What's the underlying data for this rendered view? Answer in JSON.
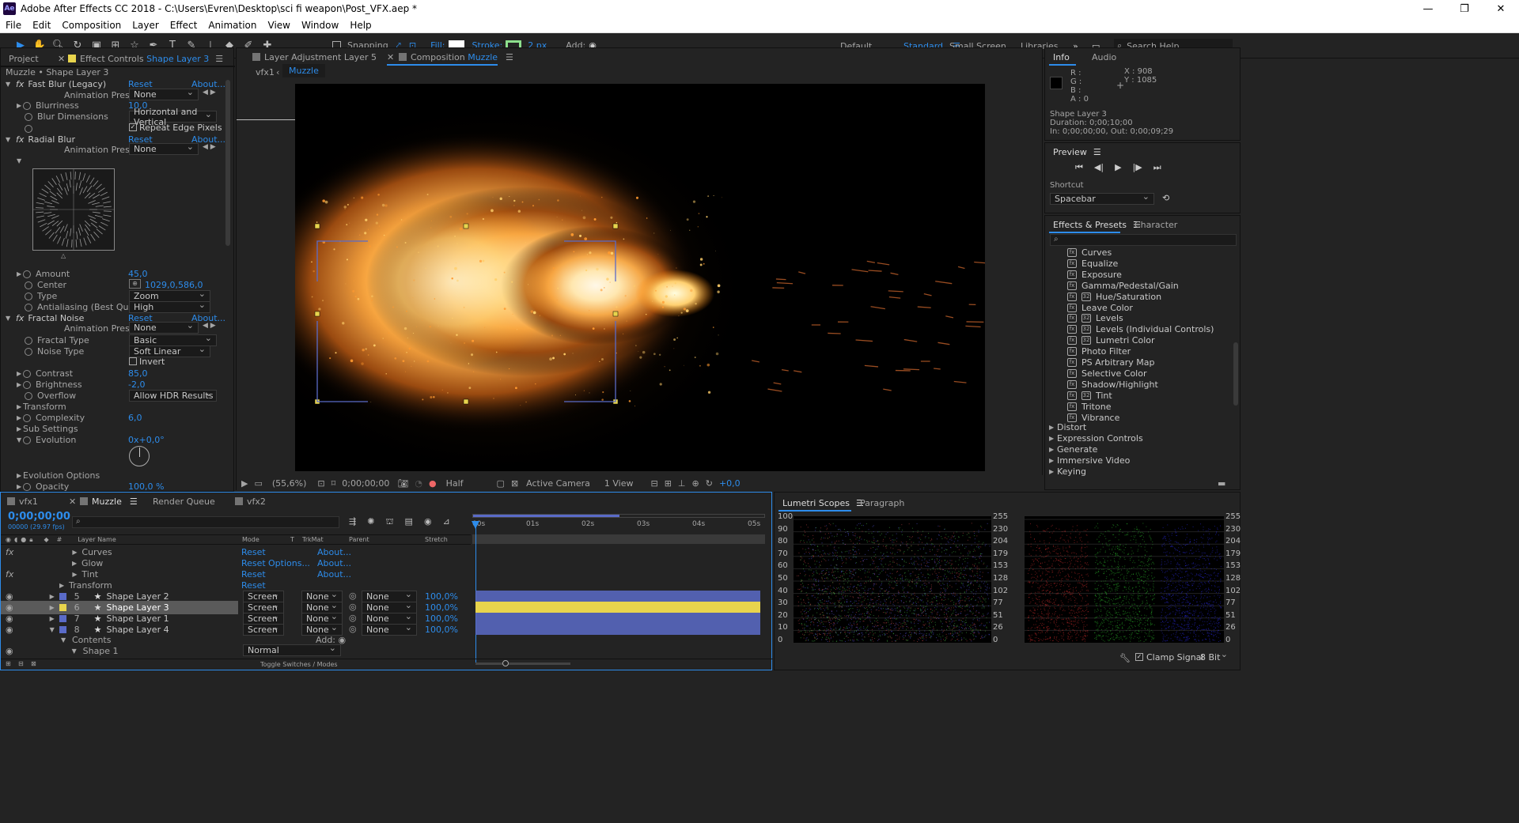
{
  "window": {
    "title": "Adobe After Effects CC 2018 - C:\\Users\\Evren\\Desktop\\sci fi weapon\\Post_VFX.aep *",
    "logo": "Ae",
    "minimize": "—",
    "maximize": "❐",
    "close": "✕"
  },
  "menu": [
    "File",
    "Edit",
    "Composition",
    "Layer",
    "Effect",
    "Animation",
    "View",
    "Window",
    "Help"
  ],
  "toolbar": {
    "snapping": "Snapping",
    "fill": "Fill:",
    "stroke": "Stroke:",
    "stroke_px": "2 px",
    "add": "Add:",
    "workspaces": [
      "Default",
      "Standard",
      "Small Screen",
      "Libraries"
    ],
    "search": "Search Help"
  },
  "left_panel": {
    "tab_project": "Project",
    "tab_effect_controls": "Effect Controls",
    "tab_layer": "Shape Layer 3",
    "subtitle": "Muzzle • Shape Layer 3",
    "fast_blur": {
      "name": "Fast Blur (Legacy)",
      "reset": "Reset",
      "about": "About...",
      "presets_label": "Animation Presets:",
      "presets_val": "None",
      "blurriness_label": "Blurriness",
      "blurriness": "10,0",
      "dims_label": "Blur Dimensions",
      "dims_val": "Horizontal and Vertical",
      "repeat_label": "Repeat Edge Pixels"
    },
    "radial_blur": {
      "name": "Radial Blur",
      "reset": "Reset",
      "about": "About...",
      "presets_label": "Animation Presets:",
      "presets_val": "None",
      "amount_label": "Amount",
      "amount": "45,0",
      "center_label": "Center",
      "center": "1029,0,586,0",
      "type_label": "Type",
      "type_val": "Zoom",
      "aa_label": "Antialiasing (Best Quality)",
      "aa_val": "High"
    },
    "fractal_noise": {
      "name": "Fractal Noise",
      "reset": "Reset",
      "about": "About...",
      "presets_label": "Animation Presets:",
      "presets_val": "None",
      "ftype_label": "Fractal Type",
      "ftype_val": "Basic",
      "ntype_label": "Noise Type",
      "ntype_val": "Soft Linear",
      "invert_label": "Invert",
      "contrast_label": "Contrast",
      "contrast": "85,0",
      "brightness_label": "Brightness",
      "brightness": "-2,0",
      "overflow_label": "Overflow",
      "overflow_val": "Allow HDR Results",
      "transform_label": "Transform",
      "complexity_label": "Complexity",
      "complexity": "6,0",
      "sub_label": "Sub Settings",
      "evolution_label": "Evolution",
      "evolution": "0x+0,0°",
      "evo_opts_label": "Evolution Options",
      "opacity_label": "Opacity",
      "opacity": "100,0 %"
    }
  },
  "viewer": {
    "tab_layer": "Layer  Adjustment Layer 5",
    "tab_comp": "Composition",
    "tab_comp_name": "Muzzle",
    "crumb_root": "vfx1",
    "crumb_current": "Muzzle",
    "zoom": "(55,6%)",
    "timecode": "0;00;00;00",
    "resolution": "Half",
    "camera": "Active Camera",
    "views": "1 View",
    "exposure": "+0,0"
  },
  "info_panel": {
    "tab_info": "Info",
    "tab_audio": "Audio",
    "r": "R :",
    "g": "G :",
    "b": "B :",
    "a": "A :  0",
    "x": "X : 908",
    "y": "Y : 1085",
    "layer": "Shape Layer 3",
    "duration": "Duration: 0;00;10;00",
    "inout": "In: 0;00;00;00, Out: 0;00;09;29"
  },
  "preview_panel": {
    "title": "Preview",
    "shortcut_label": "Shortcut",
    "shortcut_val": "Spacebar"
  },
  "effects_panel": {
    "tab_effects": "Effects & Presets",
    "tab_character": "Character",
    "items": [
      "Curves",
      "Equalize",
      "Exposure",
      "Gamma/Pedestal/Gain",
      "Hue/Saturation",
      "Leave Color",
      "Levels",
      "Levels (Individual Controls)",
      "Lumetri Color",
      "Photo Filter",
      "PS Arbitrary Map",
      "Selective Color",
      "Shadow/Highlight",
      "Tint",
      "Tritone",
      "Vibrance"
    ],
    "badge_items": [
      4,
      6,
      7,
      8,
      13
    ],
    "categories": [
      "Distort",
      "Expression Controls",
      "Generate",
      "Immersive Video",
      "Keying"
    ]
  },
  "timeline": {
    "tabs": [
      "vfx1",
      "Muzzle",
      "Render Queue",
      "vfx2"
    ],
    "timecode": "0;00;00;00",
    "frames": "00000 (29.97 fps)",
    "cols": {
      "layer_name": "Layer Name",
      "mode": "Mode",
      "t": "T",
      "trkmat": "TrkMat",
      "parent": "Parent",
      "stretch": "Stretch"
    },
    "ruler": [
      "00s",
      "01s",
      "02s",
      "03s",
      "04s",
      "05s"
    ],
    "effect_rows": [
      {
        "name": "Curves",
        "reset": "Reset",
        "about": "About..."
      },
      {
        "name": "Glow",
        "reset": "Reset",
        "options": "Options...",
        "about": "About..."
      },
      {
        "name": "Tint",
        "reset": "Reset",
        "about": "About..."
      }
    ],
    "transform": {
      "name": "Transform",
      "reset": "Reset"
    },
    "layers": [
      {
        "num": "5",
        "name": "Shape Layer 2",
        "mode": "Screen",
        "trk": "None",
        "parent": "None",
        "stretch": "100,0%",
        "color": "#5a6bc8"
      },
      {
        "num": "6",
        "name": "Shape Layer 3",
        "mode": "Screen",
        "trk": "None",
        "parent": "None",
        "stretch": "100,0%",
        "color": "#e8d44d"
      },
      {
        "num": "7",
        "name": "Shape Layer 1",
        "mode": "Screen",
        "trk": "None",
        "parent": "None",
        "stretch": "100,0%",
        "color": "#5a6bc8"
      },
      {
        "num": "8",
        "name": "Shape Layer 4",
        "mode": "Screen",
        "trk": "None",
        "parent": "None",
        "stretch": "100,0%",
        "color": "#5a6bc8"
      }
    ],
    "contents": "Contents",
    "add": "Add:",
    "shape1": "Shape 1",
    "shape_mode": "Normal",
    "toggle": "Toggle Switches / Modes"
  },
  "scopes": {
    "tab_scopes": "Lumetri Scopes",
    "tab_paragraph": "Paragraph",
    "left_scale": [
      "100",
      "90",
      "80",
      "70",
      "60",
      "50",
      "40",
      "30",
      "20",
      "10",
      "0"
    ],
    "right_scale": [
      "255",
      "230",
      "204",
      "179",
      "153",
      "128",
      "102",
      "77",
      "51",
      "26",
      "0"
    ],
    "clamp": "Clamp Signal",
    "bit": "8 Bit"
  },
  "colors": {
    "accent": "#2d8ceb",
    "panel": "#232323",
    "selected_layer": "#e8d44d",
    "layer_bar": "#5a6bc8"
  }
}
